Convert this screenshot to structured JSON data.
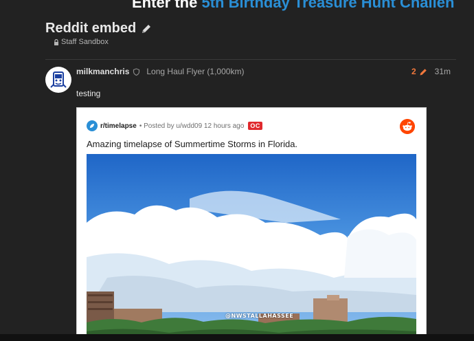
{
  "banner": {
    "prefix": "Enter the ",
    "link": "5th Birthday Treasure Hunt Challen"
  },
  "topic": {
    "title": "Reddit embed",
    "category": "Staff Sandbox"
  },
  "post": {
    "username": "milkmanchris",
    "user_title": "Long Haul Flyer (1,000km)",
    "edit_count": "2",
    "age": "31m",
    "body": "testing"
  },
  "embed": {
    "subreddit": "r/timelapse",
    "posted_by": "• Posted by u/wdd09 12 hours ago",
    "badge": "OC",
    "title": "Amazing timelapse of Summertime Storms in Florida.",
    "watermark": "@NWSTALLAHASSEE"
  },
  "colors": {
    "background": "#222222",
    "accent": "#2a8fd6",
    "edit": "#f0783c",
    "reddit": "#ff4500",
    "oc": "#e0292d"
  },
  "icons": {
    "edit_title": "pencil-icon",
    "category": "lock-icon",
    "moderator": "shield-icon",
    "edit_history": "pencil-icon",
    "subreddit": "subreddit-icon",
    "reddit": "reddit-logo-icon"
  }
}
